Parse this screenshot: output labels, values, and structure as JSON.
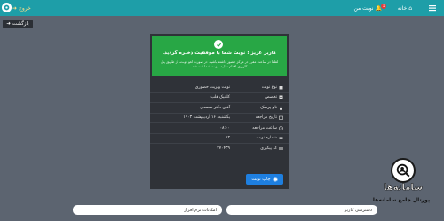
{
  "topbar": {
    "home_label": "خانه",
    "appointments_label": "نوبت من",
    "notification_count": "1",
    "exit_label": "خروج"
  },
  "back_button": {
    "label": "بازگشت"
  },
  "alert": {
    "title": "کاربر عزیز ! نوبت شما با موفقیت ذخیره گردید.",
    "description": "لطفا در ساعت مقرر در مرکز حضور داشته باشید. در صورت لغو نوبت، از طریق پنل کاربری اقدام نمایید. نوبت شما ثبت شد."
  },
  "details": [
    {
      "label": "نوع نوبت",
      "value": "نوبت ویزیت حضوری",
      "icon": "calendar-icon"
    },
    {
      "label": "تخصص",
      "value": "کلینیک قلب",
      "icon": "hospital-icon"
    },
    {
      "label": "نام پزشک",
      "value": "آقای دکتر محمدی",
      "icon": "doctor-icon"
    },
    {
      "label": "تاریخ مراجعه",
      "value": "یکشنبه، ۱۶ اردیبهشت ۱۴۰۳",
      "icon": "date-icon"
    },
    {
      "label": "ساعت مراجعه",
      "value": "۰۸:۰۰",
      "icon": "clock-icon"
    },
    {
      "label": "شماره نوبت",
      "value": "۱۲",
      "icon": "ticket-icon"
    },
    {
      "label": "کد پیگیری",
      "value": "۲۷۰۴۳۹",
      "icon": "code-icon"
    }
  ],
  "print_button": {
    "label": "چاپ نوبت"
  },
  "bottom": {
    "access_label": "دسترسی کاربر",
    "software_label": "امکانات نرم افزار"
  },
  "watermark": {
    "name": "سامانه‌ها",
    "subtitle": "پورتال جامع سامانه‌ها"
  },
  "colors": {
    "topbar": "#1e9ea8",
    "success": "#28a745",
    "primary": "#1e7fe0",
    "card": "#2f3238"
  }
}
